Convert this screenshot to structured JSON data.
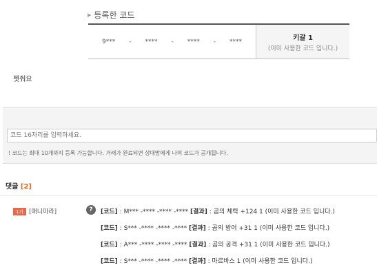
{
  "registered": {
    "heading": "등록한 코드",
    "code_parts": [
      "9***",
      "-",
      "****",
      "-",
      "****",
      "-",
      "****"
    ],
    "result_title": "키갈 1",
    "result_sub": "(이미 사용한 코드 입니다.)"
  },
  "post_text": "젯줘요",
  "input": {
    "placeholder": "코드 16자리를 입력하세요.",
    "notice": "! 코드는 최대 10개까지 등록 가능합니다. 거래가 완료되면 상대방에게 나의 코드가 공개됩니다."
  },
  "comments": {
    "title": "댓글",
    "count": "[2]",
    "author_badge": "1기",
    "author": "[애니마라]",
    "question_mark": "?",
    "code_label": "[코드]",
    "result_label": "[결과]",
    "entries": [
      {
        "code": ": M*** -**** -**** -****",
        "result": ": 곰의 체력 +124 1 (이미 사용한 코드 입니다.)"
      },
      {
        "code": ": S*** -**** -**** -****",
        "result": ": 곰의 방어 +31 1 (이미 사용한 코드 입니다.)"
      },
      {
        "code": ": A*** -**** -**** -****",
        "result": ": 곰의 공격 +31 1 (이미 사용한 코드 입니다.)"
      },
      {
        "code": ": S*** -**** -**** -****",
        "result": ": 마르바스 1 (이미 사용한 코드 입니다.)"
      }
    ]
  },
  "colors": {
    "accent": "#e8691e",
    "badge": "#e9684a"
  },
  "icons": {
    "heading_arrow": "triangle-right-icon",
    "help": "question-icon"
  }
}
